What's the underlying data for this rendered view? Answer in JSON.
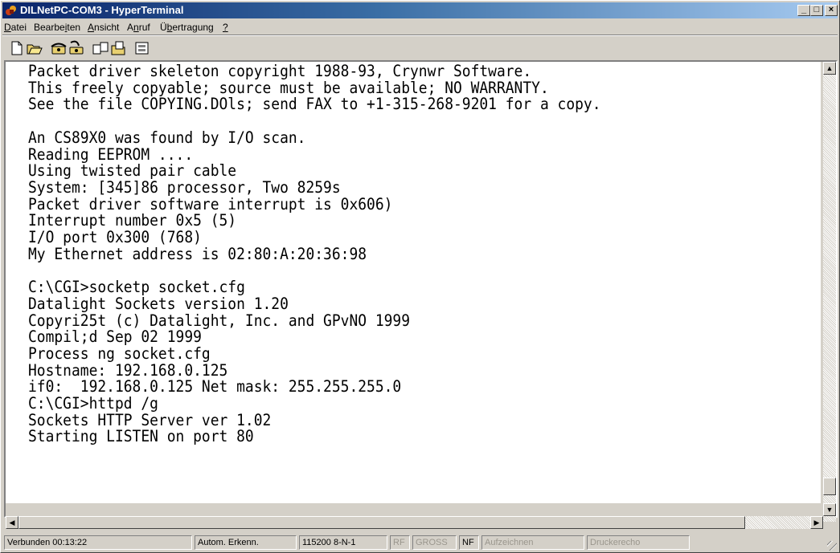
{
  "window": {
    "title": "DILNetPC-COM3 - HyperTerminal",
    "controls": {
      "minimize": "_",
      "maximize": "□",
      "close": "×"
    }
  },
  "menu": [
    {
      "pre": "",
      "key": "D",
      "post": "atei"
    },
    {
      "pre": "Bearbe",
      "key": "i",
      "post": "ten"
    },
    {
      "pre": "",
      "key": "A",
      "post": "nsicht"
    },
    {
      "pre": "A",
      "key": "n",
      "post": "ruf"
    },
    {
      "pre": "Ü",
      "key": "b",
      "post": "ertragung"
    },
    {
      "pre": "",
      "key": "?",
      "post": ""
    }
  ],
  "toolbar": {
    "icons": [
      "new-icon",
      "open-icon",
      "call-icon",
      "disconnect-icon",
      "send-icon",
      "receive-icon",
      "properties-icon"
    ]
  },
  "terminal": {
    "lines": [
      "Packet driver skeleton copyright 1988-93, Crynwr Software.",
      "This freely copyable; source must be available; NO WARRANTY.",
      "See the file COPYING.DOls; send FAX to +1-315-268-9201 for a copy.",
      "",
      "An CS89X0 was found by I/O scan.",
      "Reading EEPROM ....",
      "Using twisted pair cable",
      "System: [345]86 processor, Two 8259s",
      "Packet driver software interrupt is 0x606)",
      "Interrupt number 0x5 (5)",
      "I/O port 0x300 (768)",
      "My Ethernet address is 02:80:A:20:36:98",
      "",
      "C:\\CGI>socketp socket.cfg",
      "Datalight Sockets version 1.20",
      "Copyri25t (c) Datalight, Inc. and GPvNO 1999",
      "Compil;d Sep 02 1999",
      "Process ng socket.cfg",
      "Hostname: 192.168.0.125",
      "if0:  192.168.0.125 Net mask: 255.255.255.0",
      "C:\\CGI>httpd /g",
      "Sockets HTTP Server ver 1.02",
      "Starting LISTEN on port 80"
    ]
  },
  "status": {
    "connected": "Verbunden 00:13:22",
    "detect": "Autom. Erkenn.",
    "port_settings": "115200 8-N-1",
    "rf": "RF",
    "gross": "GROSS",
    "nf": "NF",
    "record": "Aufzeichnen",
    "print_echo": "Druckerecho"
  }
}
